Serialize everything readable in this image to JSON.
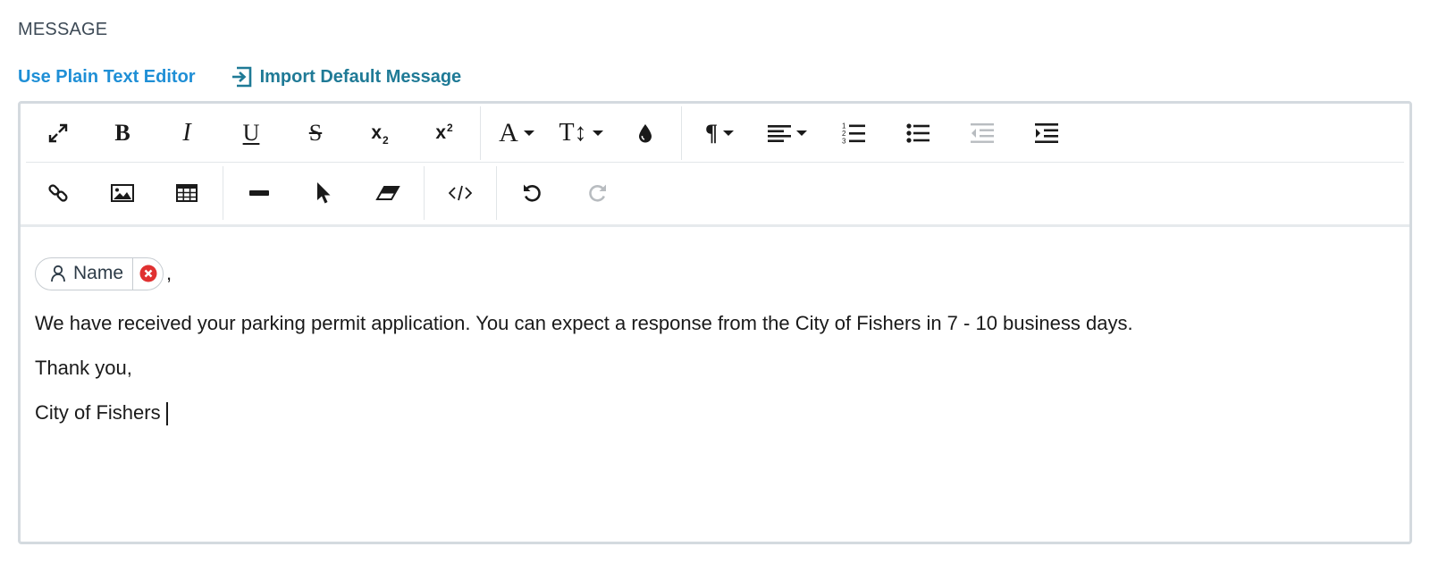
{
  "section": {
    "label": "MESSAGE"
  },
  "links": {
    "plain_text": "Use Plain Text Editor",
    "import_default": "Import Default Message"
  },
  "toolbar": {
    "row1": [
      {
        "name": "fullscreen-icon",
        "type": "icon"
      },
      {
        "name": "bold",
        "label": "B"
      },
      {
        "name": "italic",
        "label": "I"
      },
      {
        "name": "underline",
        "label": "U"
      },
      {
        "name": "strikethrough",
        "label": "S"
      },
      {
        "name": "subscript",
        "label": "x",
        "small": "2"
      },
      {
        "name": "superscript",
        "label": "x",
        "small": "2"
      },
      {
        "name": "font-family",
        "label": "A"
      },
      {
        "name": "font-size",
        "label": "T↕"
      },
      {
        "name": "text-color-icon",
        "type": "icon"
      },
      {
        "name": "paragraph-format",
        "label": "¶"
      },
      {
        "name": "align-icon",
        "type": "icon"
      },
      {
        "name": "ordered-list-icon",
        "type": "icon"
      },
      {
        "name": "unordered-list-icon",
        "type": "icon"
      },
      {
        "name": "outdent-icon",
        "type": "icon",
        "disabled": true
      },
      {
        "name": "indent-icon",
        "type": "icon"
      }
    ],
    "row2": [
      "link-icon",
      "image-icon",
      "table-icon",
      "horizontal-rule-icon",
      "select-all-icon",
      "clear-formatting-icon",
      "code-view-icon",
      "undo-icon",
      "redo-icon"
    ]
  },
  "content": {
    "chip_label": "Name",
    "comma": ",",
    "body": "We have received your parking permit application. You can expect a response from the City of Fishers in 7 - 10 business days.",
    "thanks": "Thank you,",
    "signature": "City of Fishers"
  },
  "colors": {
    "link_blue": "#1f8fd6",
    "import_teal": "#1f7a96",
    "chip_remove_red": "#e03131",
    "border": "#d4dadf",
    "disabled": "#b8bcc0"
  }
}
